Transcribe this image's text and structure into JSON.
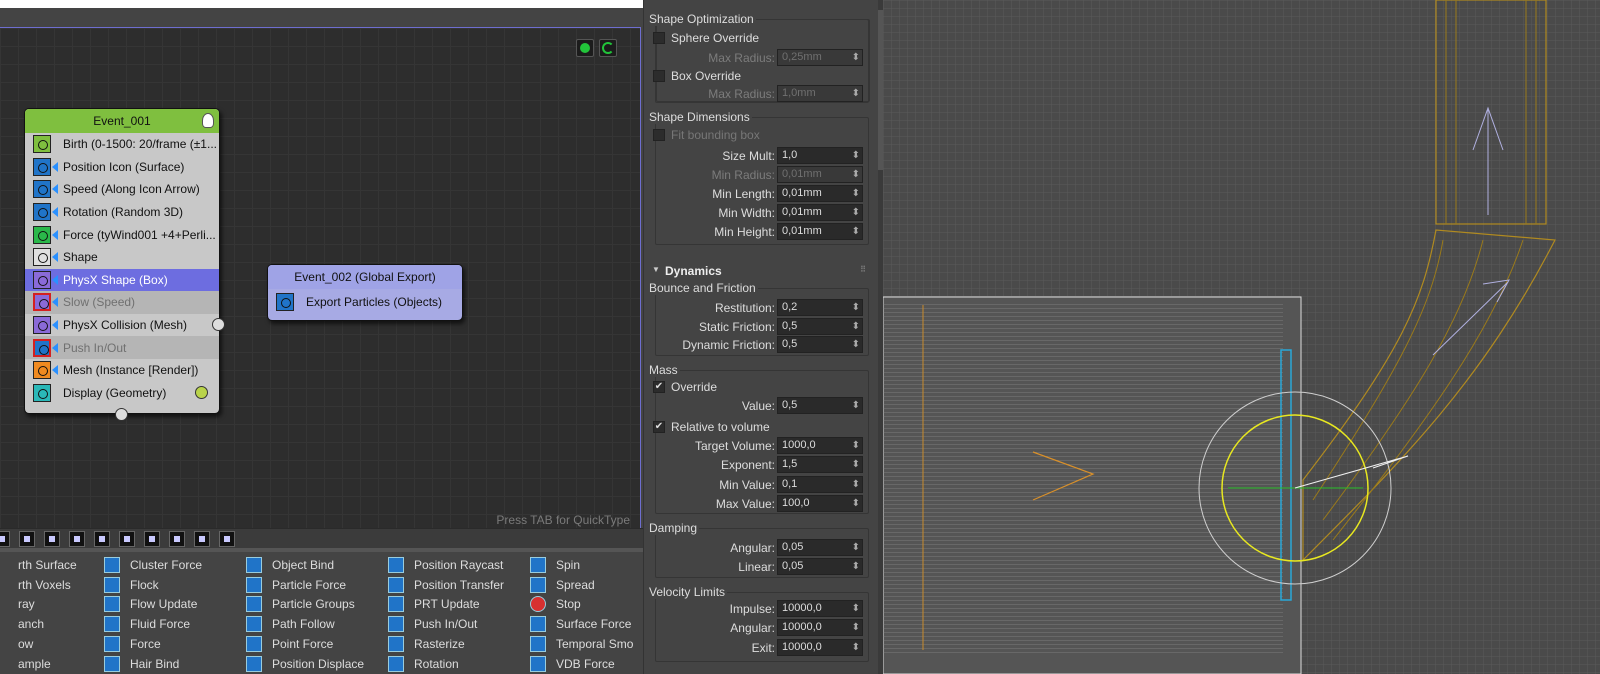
{
  "particle_view": {
    "hint": "Press TAB for QuickType",
    "event1": {
      "title": "Event_001",
      "operators": [
        {
          "label": "Birth (0-1500: 20/frame (±1...",
          "state": "normal",
          "color": "#7fbf3f"
        },
        {
          "label": "Position Icon (Surface)",
          "state": "normal",
          "color": "#2074c8"
        },
        {
          "label": "Speed (Along Icon Arrow)",
          "state": "normal",
          "color": "#2074c8"
        },
        {
          "label": "Rotation (Random 3D)",
          "state": "normal",
          "color": "#2074c8"
        },
        {
          "label": "Force (tyWind001 +4+Perli...",
          "state": "normal",
          "color": "#2ab84a"
        },
        {
          "label": "Shape",
          "state": "normal",
          "color": "#e0e0e0"
        },
        {
          "label": "PhysX Shape (Box)",
          "state": "selected",
          "color": "#8a6ad8"
        },
        {
          "label": "Slow (Speed)",
          "state": "disabled",
          "color": "#8a6ad8"
        },
        {
          "label": "PhysX Collision (Mesh)",
          "state": "normal",
          "color": "#8a6ad8"
        },
        {
          "label": "Push In/Out",
          "state": "disabled",
          "color": "#2074c8"
        },
        {
          "label": "Mesh (Instance [Render])",
          "state": "normal",
          "color": "#f08a20"
        },
        {
          "label": "Display (Geometry)",
          "state": "normal",
          "color": "#2ab8b8"
        }
      ]
    },
    "event2": {
      "title": "Event_002 (Global Export)",
      "operators": [
        {
          "label": "Export Particles (Objects)",
          "color": "#2074c8"
        }
      ]
    }
  },
  "depot": {
    "columns": [
      [
        "rth Surface",
        "rth Voxels",
        "ray",
        "anch",
        "ow",
        "ample"
      ],
      [
        "Cluster Force",
        "Flock",
        "Flow Update",
        "Fluid Force",
        "Force",
        "Hair Bind"
      ],
      [
        "Object Bind",
        "Particle Force",
        "Particle Groups",
        "Path Follow",
        "Point Force",
        "Position Displace"
      ],
      [
        "Position Raycast",
        "Position Transfer",
        "PRT Update",
        "Push In/Out",
        "Rasterize",
        "Rotation"
      ],
      [
        "Spin",
        "Spread",
        "Stop",
        "Surface Force",
        "Temporal Smo",
        "VDB Force"
      ]
    ]
  },
  "command_panel": {
    "shape_optimization": {
      "title": "Shape Optimization",
      "sphere_override": "Sphere Override",
      "sphere_max_radius_label": "Max Radius:",
      "sphere_max_radius": "0,25mm",
      "box_override": "Box Override",
      "box_max_radius_label": "Max Radius:",
      "box_max_radius": "1,0mm"
    },
    "shape_dimensions": {
      "title": "Shape Dimensions",
      "fit_bounding_box": "Fit bounding box",
      "rows": [
        {
          "label": "Size Mult:",
          "value": "1,0",
          "dim": false
        },
        {
          "label": "Min Radius:",
          "value": "0,01mm",
          "dim": true
        },
        {
          "label": "Min Length:",
          "value": "0,01mm",
          "dim": false
        },
        {
          "label": "Min Width:",
          "value": "0,01mm",
          "dim": false
        },
        {
          "label": "Min Height:",
          "value": "0,01mm",
          "dim": false
        }
      ]
    },
    "dynamics": {
      "title": "Dynamics",
      "bounce": {
        "title": "Bounce and Friction",
        "rows": [
          {
            "label": "Restitution:",
            "value": "0,2"
          },
          {
            "label": "Static Friction:",
            "value": "0,5"
          },
          {
            "label": "Dynamic Friction:",
            "value": "0,5"
          }
        ]
      },
      "mass": {
        "title": "Mass",
        "override": "Override",
        "value_label": "Value:",
        "value": "0,5",
        "relative": "Relative to volume",
        "rows": [
          {
            "label": "Target Volume:",
            "value": "1000,0"
          },
          {
            "label": "Exponent:",
            "value": "1,5"
          },
          {
            "label": "Min Value:",
            "value": "0,1"
          },
          {
            "label": "Max Value:",
            "value": "100,0"
          }
        ]
      },
      "damping": {
        "title": "Damping",
        "rows": [
          {
            "label": "Angular:",
            "value": "0,05"
          },
          {
            "label": "Linear:",
            "value": "0,05"
          }
        ]
      },
      "velocity": {
        "title": "Velocity Limits",
        "rows": [
          {
            "label": "Impulse:",
            "value": "10000,0"
          },
          {
            "label": "Angular:",
            "value": "10000,0"
          },
          {
            "label": "Exit:",
            "value": "10000,0"
          }
        ]
      }
    }
  }
}
